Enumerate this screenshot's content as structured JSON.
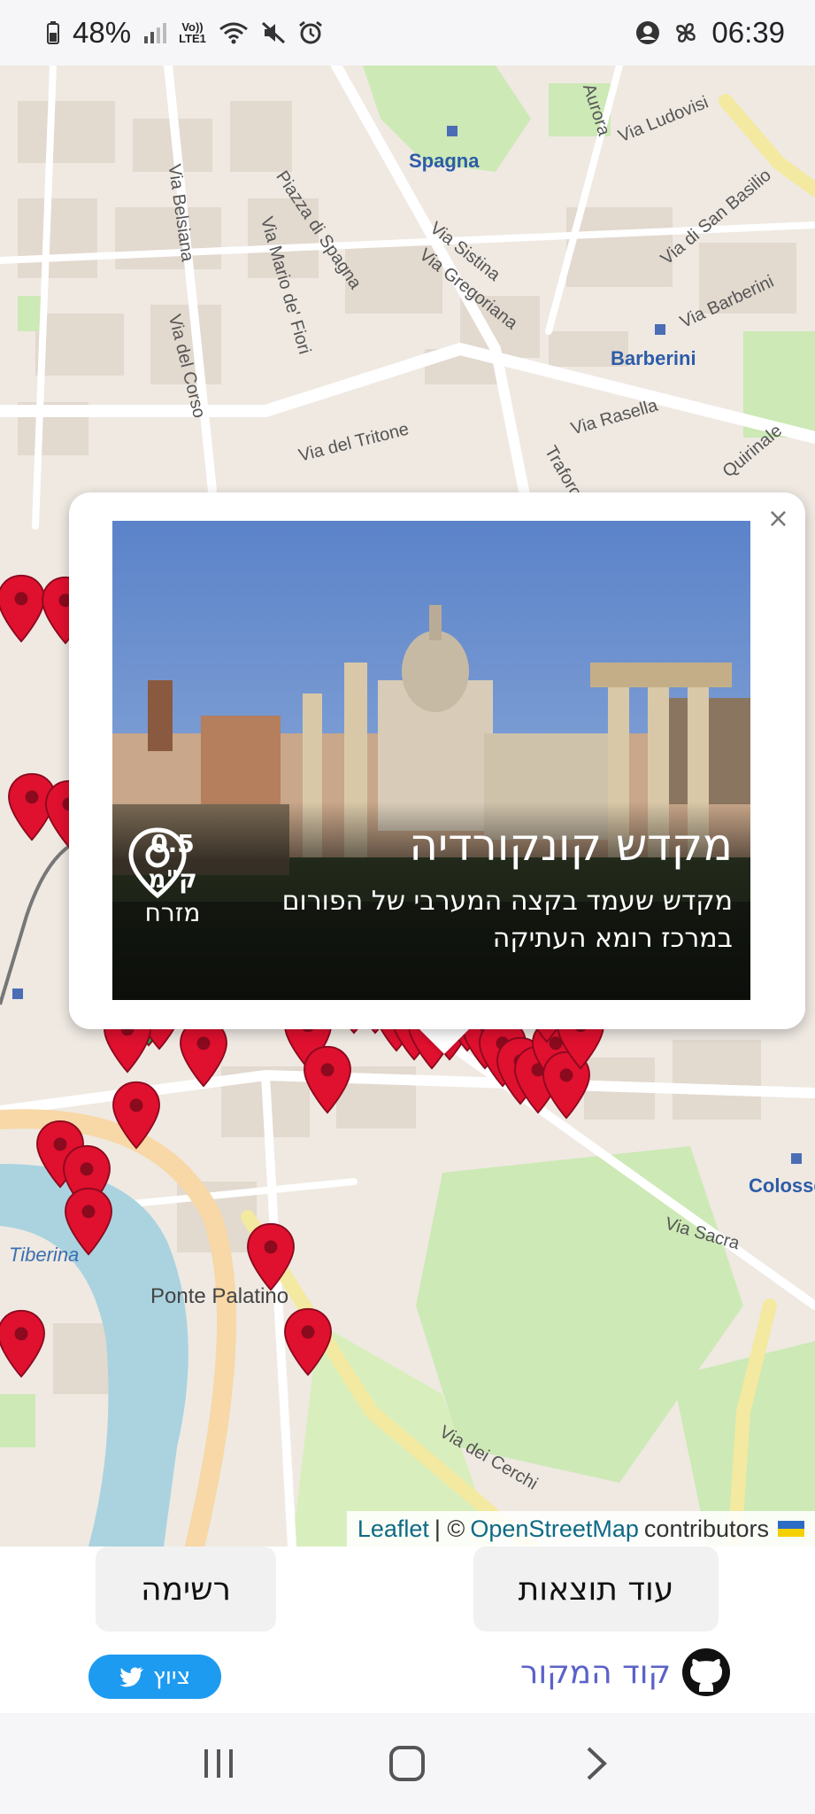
{
  "status_bar": {
    "battery": "48%",
    "network": "LTE1",
    "time": "06:39"
  },
  "map": {
    "street_labels": [
      "Via Ludovisi",
      "Via Sistina",
      "Via Gregoriana",
      "Via di San Basilio",
      "Via Barberini",
      "Via Rasella",
      "Via del Tritone",
      "Via Belsiana",
      "Via del Corso",
      "Via Mario de' Fiori",
      "Piazza di Spagna",
      "Via Sacra",
      "Via dei Cerchi",
      "Aurora",
      "Traforo",
      "Quirinale"
    ],
    "station_labels": [
      "Spagna",
      "Barberini",
      "Colosseo"
    ],
    "place_labels": [
      "Ponte Palatino",
      "Tiberina"
    ],
    "attribution": {
      "leaflet": "Leaflet",
      "separator": "| ©",
      "osm": "OpenStreetMap",
      "contributors": "contributors"
    }
  },
  "popup": {
    "close": "×",
    "title": "מקדש קונקורדיה",
    "description": "מקדש שעמד בקצה המערבי של הפורום במרכז רומא העתיקה",
    "distance": "0.5 ק\"מ",
    "direction": "מזרח"
  },
  "controls": {
    "list_button": "רשימה",
    "more_results_button": "עוד תוצאות",
    "tweet_button": "ציוץ",
    "source_code_link": "קוד המקור"
  },
  "colors": {
    "pin_red": "#e0102f",
    "pin_green": "#1fa34a",
    "tweet_blue": "#1d9bf0",
    "link_purple": "#5b62c9"
  }
}
